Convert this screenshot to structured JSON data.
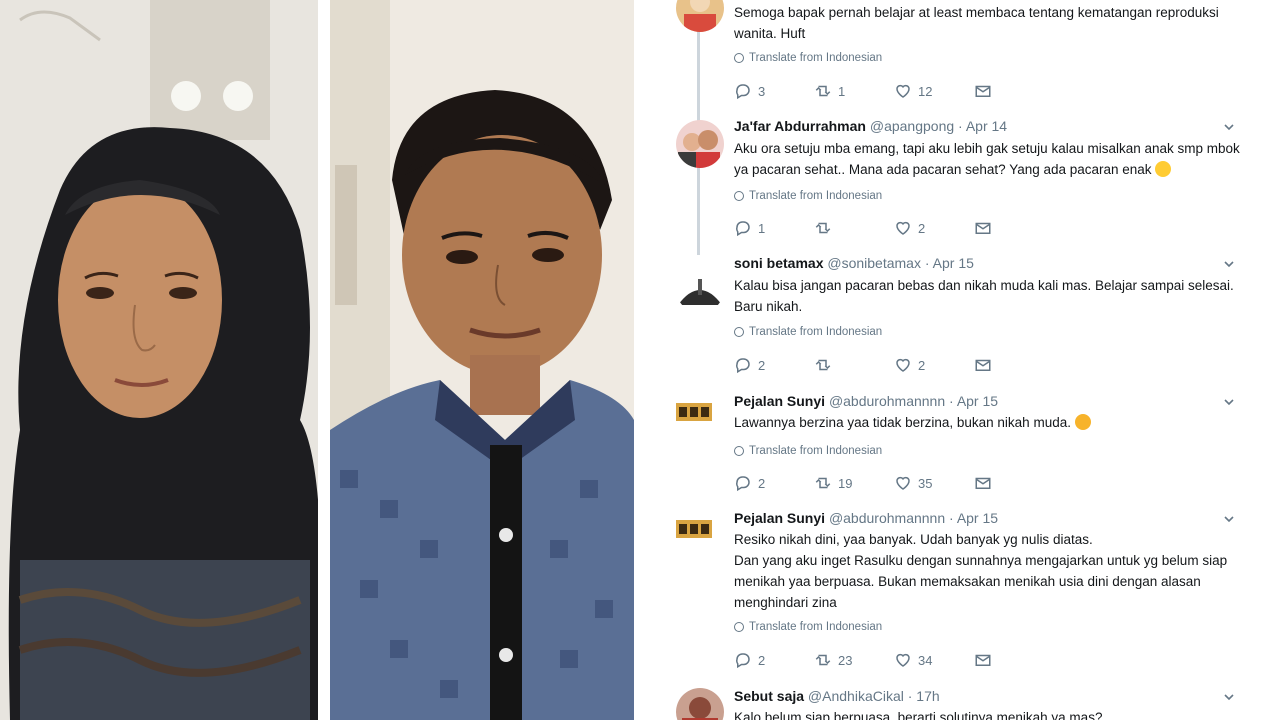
{
  "tweets": [
    {
      "text": "Semoga bapak pernah belajar at least membaca tentang kematangan reproduksi wanita. Huft",
      "translate": "Translate from Indonesian",
      "replies": "3",
      "retweets": "1",
      "likes": "12"
    },
    {
      "name": "Ja'far Abdurrahman",
      "handle": "@apangpong",
      "time": "Apr 14",
      "text": "Aku ora setuju mba emang,  tapi aku lebih gak setuju kalau misalkan anak smp mbok ya pacaran sehat.. Mana ada pacaran sehat?  Yang ada pacaran enak",
      "translate": "Translate from Indonesian",
      "replies": "1",
      "retweets": "",
      "likes": "2"
    },
    {
      "name": "soni betamax",
      "handle": "@sonibetamax",
      "time": "Apr 15",
      "text": "Kalau bisa jangan pacaran bebas dan nikah muda kali mas. Belajar sampai selesai. Baru nikah.",
      "translate": "Translate from Indonesian",
      "replies": "2",
      "retweets": "",
      "likes": "2"
    },
    {
      "name": "Pejalan Sunyi",
      "handle": "@abdurohmannnn",
      "time": "Apr 15",
      "text": "Lawannya berzina yaa tidak berzina, bukan nikah muda.",
      "translate": "Translate from Indonesian",
      "replies": "2",
      "retweets": "19",
      "likes": "35"
    },
    {
      "name": "Pejalan Sunyi",
      "handle": "@abdurohmannnn",
      "time": "Apr 15",
      "text": "Resiko nikah dini, yaa banyak. Udah banyak yg nulis diatas.\nDan yang aku inget Rasulku dengan sunnahnya mengajarkan untuk yg belum siap menikah yaa berpuasa. Bukan memaksakan menikah usia dini dengan alasan menghindari zina",
      "translate": "Translate from Indonesian",
      "replies": "2",
      "retweets": "23",
      "likes": "34"
    },
    {
      "name": "Sebut saja",
      "handle": "@AndhikaCikal",
      "time": "17h",
      "text": "Kalo belum siap berpuasa, berarti solutinya menikah ya mas?"
    }
  ],
  "separator": "·",
  "colors": {
    "text": "#14171a",
    "muted": "#657786",
    "thread_line": "#cdd5dc"
  },
  "icons": [
    "reply-icon",
    "retweet-icon",
    "like-icon",
    "message-icon",
    "chevron-down-icon",
    "globe-icon"
  ]
}
